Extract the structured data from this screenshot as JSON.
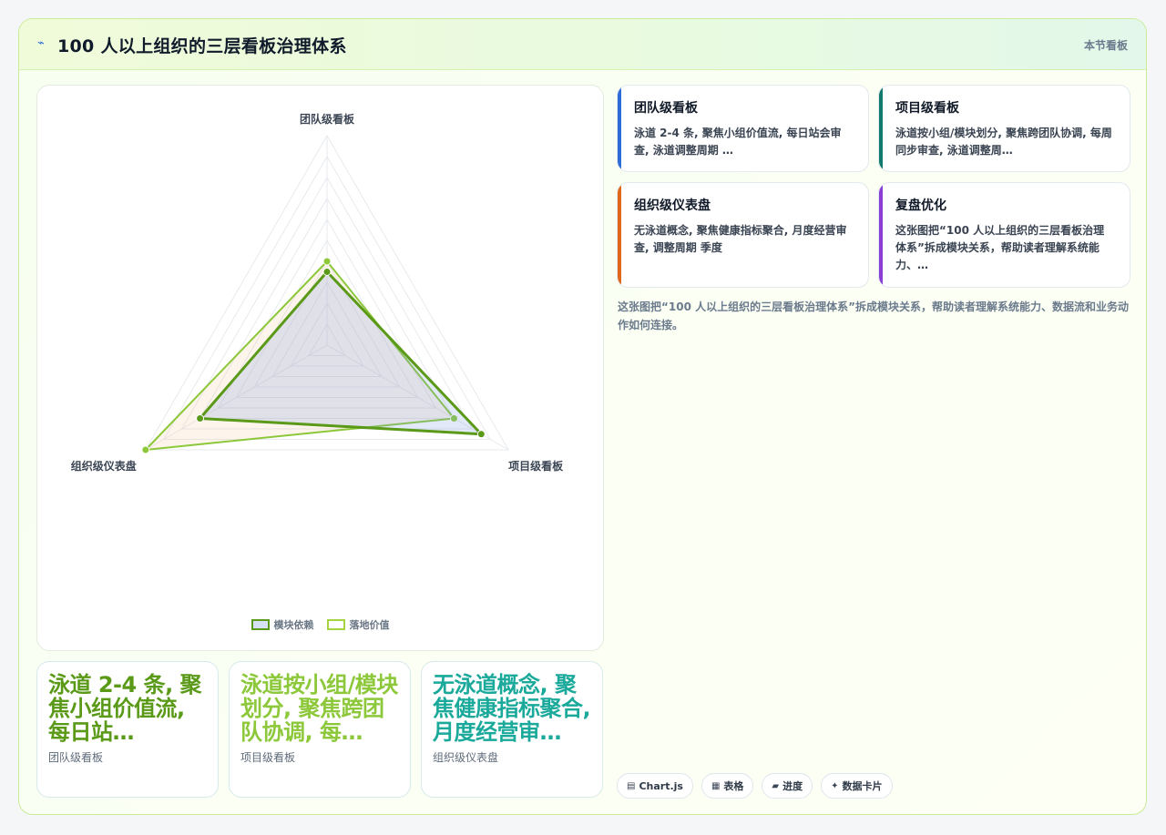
{
  "header": {
    "title": "100 人以上组织的三层看板治理体系",
    "right_tag": "本节看板"
  },
  "chart_data": {
    "type": "radar",
    "axes": [
      "团队级看板",
      "项目级看板",
      "组织级仪表盘"
    ],
    "rmax": 10,
    "series": [
      {
        "name": "模块依赖",
        "values": [
          3.5,
          8.5,
          7.0
        ],
        "color": "#5a9a18",
        "fill": "rgba(124,154,222,0.22)"
      },
      {
        "name": "落地价值",
        "values": [
          4.0,
          7.0,
          10.0
        ],
        "color": "#8cc83a",
        "fill": "rgba(244,196,150,0.18)"
      }
    ]
  },
  "metrics": [
    {
      "value": "泳道 2-4 条, 聚焦小组价值流, 每日站…",
      "label": "团队级看板",
      "color": "#5a9a18"
    },
    {
      "value": "泳道按小组/模块划分, 聚焦跨团队协调, 每…",
      "label": "项目级看板",
      "color": "#8cc83a"
    },
    {
      "value": "无泳道概念, 聚焦健康指标聚合, 月度经营审…",
      "label": "组织级仪表盘",
      "color": "#1aa99a"
    }
  ],
  "cards": [
    {
      "title": "团队级看板",
      "body": "泳道 2-4 条, 聚焦小组价值流, 每日站会审查, 泳道调整周期 …",
      "accent": "#2d6cd6"
    },
    {
      "title": "项目级看板",
      "body": "泳道按小组/模块划分, 聚焦跨团队协调, 每周同步审查, 泳道调整周…",
      "accent": "#117a6e"
    },
    {
      "title": "组织级仪表盘",
      "body": "无泳道概念, 聚焦健康指标聚合, 月度经营审查, 调整周期 季度",
      "accent": "#e0681a"
    },
    {
      "title": "复盘优化",
      "body": "这张图把“100 人以上组织的三层看板治理体系”拆成模块关系，帮助读者理解系统能力、…",
      "accent": "#8a3ed6"
    }
  ],
  "description": "这张图把“100 人以上组织的三层看板治理体系”拆成模块关系，帮助读者理解系统能力、数据流和业务动作如何连接。",
  "chips": [
    {
      "icon": "▤",
      "label": "Chart.js"
    },
    {
      "icon": "▦",
      "label": "表格"
    },
    {
      "icon": "▰",
      "label": "进度"
    },
    {
      "icon": "✦",
      "label": "数据卡片"
    }
  ]
}
